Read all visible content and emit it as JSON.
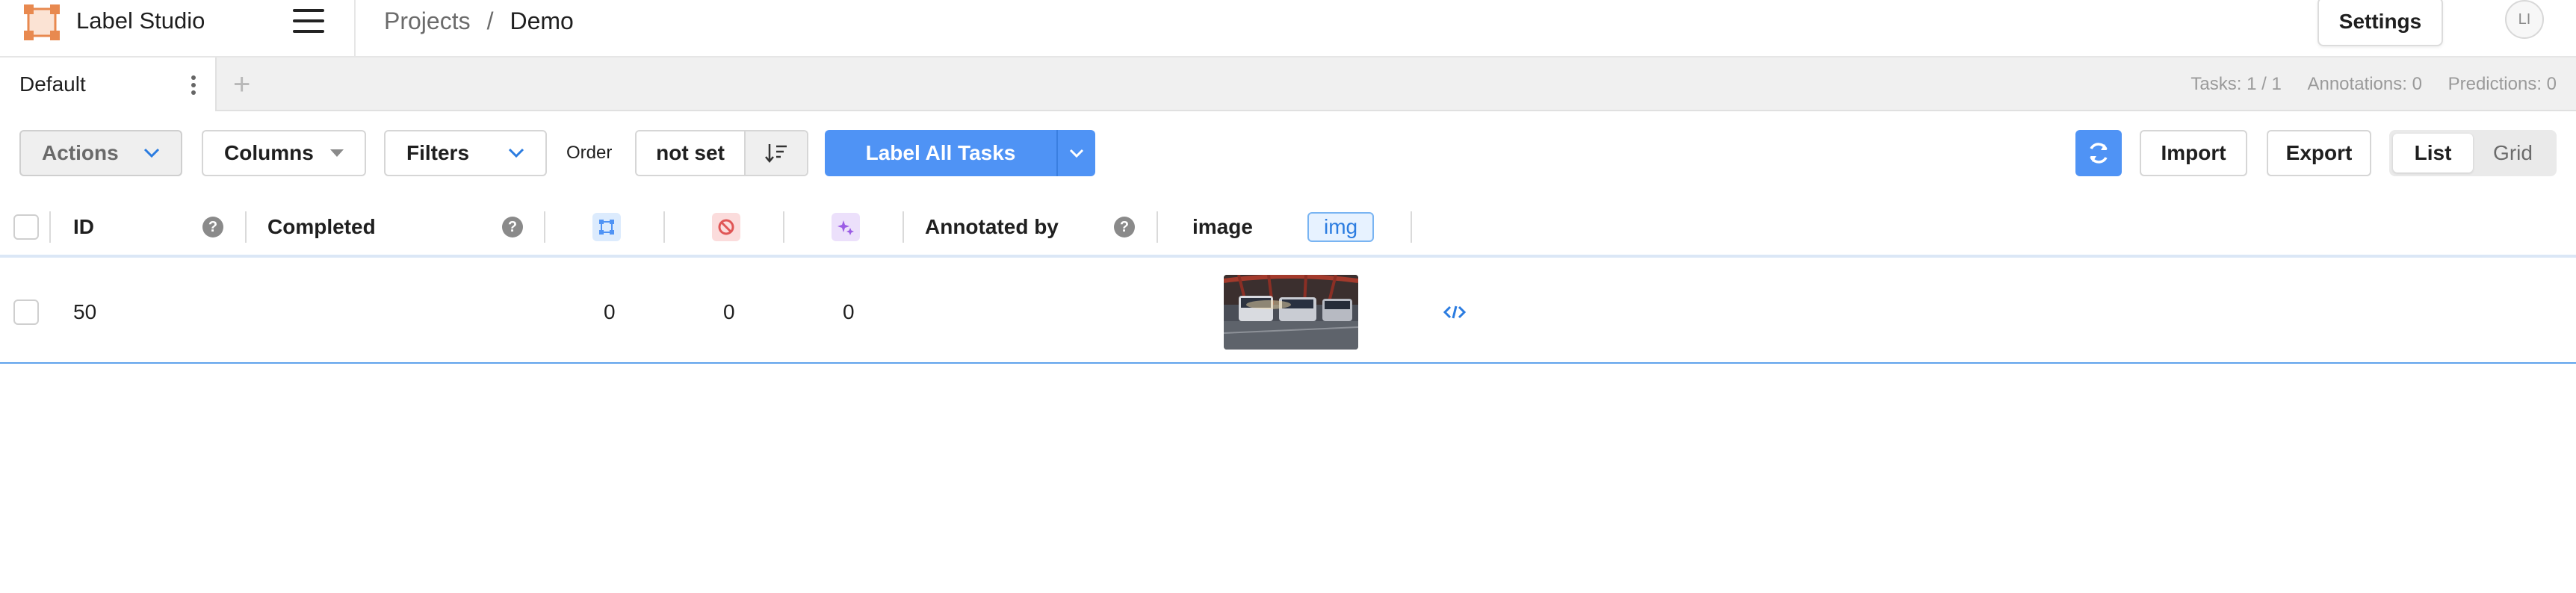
{
  "app": {
    "brand": "Label Studio"
  },
  "breadcrumb": {
    "projects": "Projects",
    "separator": "/",
    "current": "Demo"
  },
  "header": {
    "settings_label": "Settings",
    "avatar_initials": "LI"
  },
  "tabs": [
    {
      "label": "Default"
    }
  ],
  "add_tab_glyph": "+",
  "stats": {
    "tasks": "Tasks: 1 / 1",
    "annotations": "Annotations: 0",
    "predictions": "Predictions: 0"
  },
  "toolbar": {
    "actions_label": "Actions",
    "columns_label": "Columns",
    "filters_label": "Filters",
    "order_label": "Order",
    "order_value": "not set",
    "label_all_label": "Label All Tasks",
    "import_label": "Import",
    "export_label": "Export",
    "view_list": "List",
    "view_grid": "Grid",
    "active_view": "List"
  },
  "table": {
    "columns": {
      "id": "ID",
      "completed": "Completed",
      "annotated_by": "Annotated by",
      "image": "image",
      "image_badge": "img",
      "help_glyph": "?"
    },
    "column_icons": [
      "annotations-count-icon",
      "cancelled-count-icon",
      "predictions-count-icon"
    ],
    "rows": [
      {
        "id": "50",
        "completed": "",
        "total_annotations": "0",
        "cancelled_annotations": "0",
        "total_predictions": "0",
        "annotated_by": "",
        "image": "bus-station-thumbnail"
      }
    ]
  },
  "colors": {
    "accent": "#4f93f5",
    "logo": "#e8894f",
    "cancel": "#e05555",
    "prediction": "#9b5ce5",
    "row_border": "#5fa3ec"
  }
}
